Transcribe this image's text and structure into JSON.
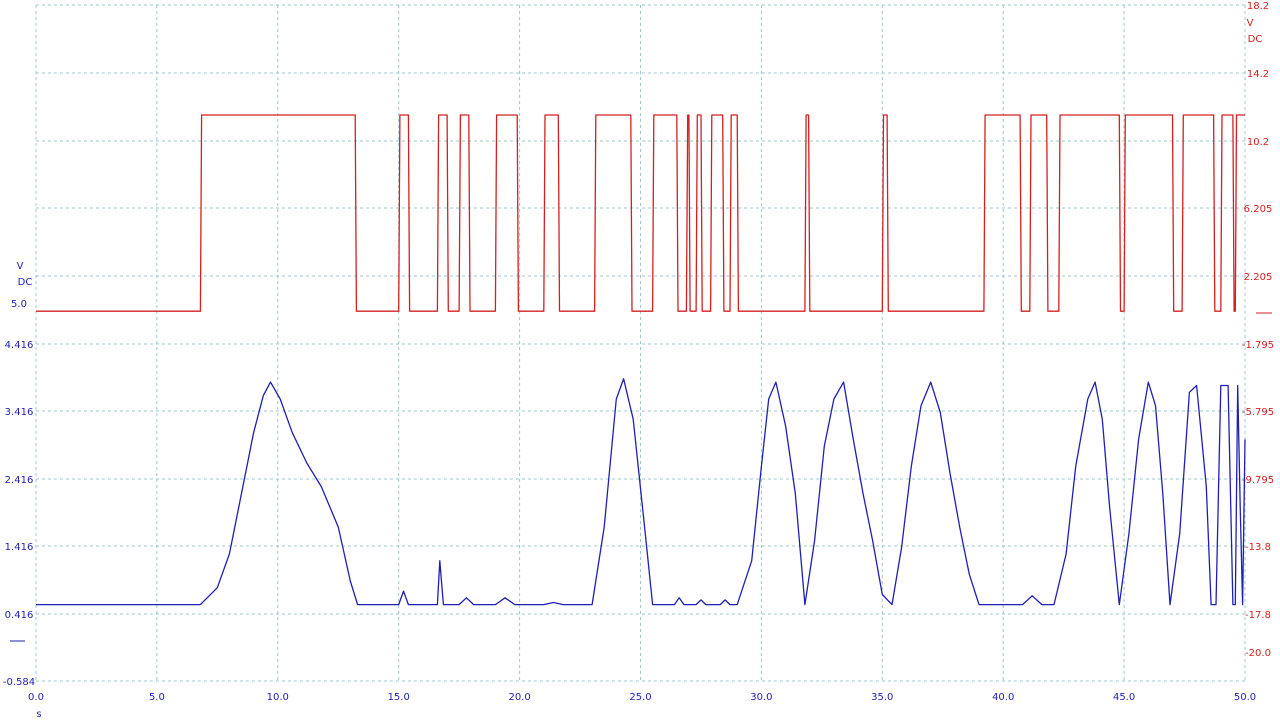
{
  "chart_data": {
    "type": "line",
    "x_axis": {
      "label": "s",
      "range": [
        0,
        50
      ],
      "ticks": [
        "0.0",
        "5.0",
        "10.0",
        "15.0",
        "20.0",
        "25.0",
        "30.0",
        "35.0",
        "40.0",
        "45.0",
        "50.0"
      ]
    },
    "left_axis": {
      "unit": "V",
      "coupling": "DC",
      "color": "#1f1fb4",
      "ticks": [
        "5.0",
        "4.416",
        "3.416",
        "2.416",
        "1.416",
        "0.416",
        "-0.584"
      ]
    },
    "right_axis": {
      "unit": "V",
      "coupling": "DC",
      "color": "#d42020",
      "ticks": [
        "18.2",
        "14.2",
        "10.2",
        "6.205",
        "2.205",
        "-1.795",
        "-5.795",
        "-9.795",
        "-13.8",
        "-17.8",
        "-20.0"
      ]
    },
    "grid": true,
    "series": [
      {
        "color": "#d42020",
        "axis": "right",
        "low": 0.1,
        "high": 11.7,
        "x": [
          0,
          6.8,
          6.85,
          13.2,
          13.25,
          15.0,
          15.05,
          15.4,
          15.45,
          16.6,
          16.65,
          17.0,
          17.05,
          17.5,
          17.55,
          17.9,
          17.95,
          19.0,
          19.05,
          19.9,
          19.95,
          21.0,
          21.05,
          21.6,
          21.65,
          23.1,
          23.15,
          24.6,
          24.65,
          25.5,
          25.55,
          26.5,
          26.55,
          26.9,
          26.95,
          27.0,
          27.05,
          27.3,
          27.35,
          27.5,
          27.55,
          27.9,
          27.95,
          28.4,
          28.45,
          28.7,
          28.75,
          29.0,
          29.05,
          31.8,
          31.85,
          31.95,
          32.0,
          35.0,
          35.05,
          35.2,
          35.25,
          39.2,
          39.25,
          40.7,
          40.75,
          41.1,
          41.15,
          41.8,
          41.85,
          42.3,
          42.35,
          44.8,
          44.85,
          45.0,
          45.05,
          47.0,
          47.05,
          47.4,
          47.45,
          48.7,
          48.75,
          49.0,
          49.05,
          49.5,
          49.55,
          49.6,
          49.65,
          50.0
        ],
        "y": [
          0.1,
          0.1,
          11.7,
          11.7,
          0.1,
          0.1,
          11.7,
          11.7,
          0.1,
          0.1,
          11.7,
          11.7,
          0.1,
          0.1,
          11.7,
          11.7,
          0.1,
          0.1,
          11.7,
          11.7,
          0.1,
          0.1,
          11.7,
          11.7,
          0.1,
          0.1,
          11.7,
          11.7,
          0.1,
          0.1,
          11.7,
          11.7,
          0.1,
          0.1,
          11.7,
          11.7,
          0.1,
          0.1,
          11.7,
          11.7,
          0.1,
          0.1,
          11.7,
          11.7,
          0.1,
          0.1,
          11.7,
          11.7,
          0.1,
          0.1,
          11.7,
          11.7,
          0.1,
          0.1,
          11.7,
          11.7,
          0.1,
          0.1,
          11.7,
          11.7,
          0.1,
          0.1,
          11.7,
          11.7,
          0.1,
          0.1,
          11.7,
          11.7,
          0.1,
          0.1,
          11.7,
          11.7,
          0.1,
          0.1,
          11.7,
          11.7,
          0.1,
          0.1,
          11.7,
          11.7,
          0.1,
          0.1,
          11.7,
          11.7
        ]
      },
      {
        "color": "#1f1fb4",
        "axis": "left",
        "x": [
          0,
          6.8,
          7.5,
          8.0,
          8.5,
          9.0,
          9.4,
          9.7,
          10.1,
          10.6,
          11.2,
          11.8,
          12.5,
          13.0,
          13.3,
          15.0,
          15.2,
          15.4,
          16.6,
          16.7,
          16.85,
          17.5,
          17.8,
          18.1,
          19.0,
          19.4,
          19.8,
          21.0,
          21.4,
          21.8,
          23.0,
          23.5,
          24.0,
          24.3,
          24.7,
          25.2,
          25.5,
          26.4,
          26.6,
          26.8,
          27.3,
          27.5,
          27.7,
          28.3,
          28.5,
          28.7,
          29.0,
          29.6,
          30.0,
          30.3,
          30.6,
          31.0,
          31.4,
          31.8,
          32.2,
          32.6,
          33.0,
          33.4,
          33.8,
          34.2,
          34.6,
          35.0,
          35.4,
          35.8,
          36.2,
          36.6,
          37.0,
          37.4,
          37.8,
          38.2,
          38.6,
          39.0,
          39.3,
          40.8,
          41.2,
          41.6,
          42.1,
          42.6,
          43.0,
          43.5,
          43.8,
          44.1,
          44.4,
          44.8,
          45.2,
          45.6,
          46.0,
          46.3,
          46.6,
          46.9,
          47.3,
          47.7,
          48.0,
          48.4,
          48.6,
          48.8,
          49.0,
          49.3,
          49.5,
          49.6,
          49.7,
          49.8,
          49.9,
          50.0
        ],
        "y": [
          0.55,
          0.55,
          0.8,
          1.3,
          2.2,
          3.1,
          3.65,
          3.85,
          3.6,
          3.1,
          2.65,
          2.3,
          1.7,
          0.9,
          0.55,
          0.55,
          0.75,
          0.55,
          0.55,
          1.2,
          0.55,
          0.55,
          0.65,
          0.55,
          0.55,
          0.65,
          0.55,
          0.55,
          0.58,
          0.55,
          0.55,
          1.7,
          3.6,
          3.9,
          3.3,
          1.6,
          0.55,
          0.55,
          0.65,
          0.55,
          0.55,
          0.62,
          0.55,
          0.55,
          0.62,
          0.55,
          0.55,
          1.2,
          2.6,
          3.6,
          3.85,
          3.2,
          2.2,
          0.55,
          1.5,
          2.9,
          3.6,
          3.85,
          3.0,
          2.2,
          1.5,
          0.7,
          0.55,
          1.4,
          2.6,
          3.5,
          3.85,
          3.4,
          2.5,
          1.7,
          1.0,
          0.55,
          0.55,
          0.55,
          0.68,
          0.55,
          0.55,
          1.3,
          2.6,
          3.6,
          3.85,
          3.3,
          2.0,
          0.55,
          1.6,
          3.0,
          3.85,
          3.5,
          2.2,
          0.55,
          1.6,
          3.7,
          3.8,
          2.3,
          0.55,
          0.55,
          3.8,
          3.8,
          0.55,
          0.55,
          3.8,
          2.0,
          0.55,
          3.0
        ]
      }
    ]
  }
}
